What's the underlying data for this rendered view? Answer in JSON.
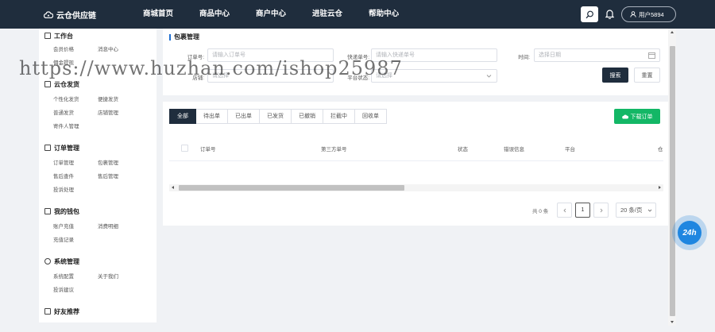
{
  "brand": {
    "name": "云仓供应链"
  },
  "nav": {
    "items": [
      "商城首页",
      "商品中心",
      "商户中心",
      "进驻云仓",
      "帮助中心"
    ]
  },
  "user": {
    "label": "用户5894"
  },
  "sidebar": {
    "sections": [
      {
        "title": "工作台",
        "icon": "desktop-icon",
        "items": [
          "会员价格",
          "消息中心",
          "佣金提现"
        ]
      },
      {
        "title": "云仓发货",
        "icon": "grid-icon",
        "items": [
          "个性化发货",
          "便捷发货",
          "普通发货",
          "店铺管理",
          "寄件人管理"
        ]
      },
      {
        "title": "订单管理",
        "icon": "list-icon",
        "items": [
          "订单管理",
          "包裹管理",
          "售后查件",
          "售后管理",
          "投诉处理"
        ]
      },
      {
        "title": "我的钱包",
        "icon": "wallet-icon",
        "items": [
          "账户充值",
          "消费明细",
          "充值记录"
        ]
      },
      {
        "title": "系统管理",
        "icon": "gear-icon",
        "items": [
          "系统配置",
          "关于我们",
          "投诉建议"
        ]
      },
      {
        "title": "好友推荐",
        "icon": "gift-icon",
        "items": []
      }
    ]
  },
  "filter": {
    "title": "包裹管理",
    "order_label": "订单号:",
    "order_placeholder": "请输入订单号",
    "express_label": "快递单号:",
    "express_placeholder": "请输入快递单号",
    "time_label": "时间:",
    "time_placeholder": "选择日期",
    "shop_label": "店铺:",
    "shop_placeholder": "请选择",
    "platform_label": "平台状态:",
    "platform_placeholder": "请选择",
    "search_label": "搜索",
    "reset_label": "重置"
  },
  "table": {
    "tabs": [
      "全部",
      "待出单",
      "已出单",
      "已发货",
      "已撤销",
      "拦截中",
      "回收单"
    ],
    "active_tab": 0,
    "download_label": "下载订单",
    "columns": [
      "订单号",
      "第三方单号",
      "状态",
      "错误信息",
      "平台",
      "仓"
    ]
  },
  "pager": {
    "total": "共 0 条",
    "current": "1",
    "page_size": "20 条/页"
  },
  "support": {
    "label": "24h"
  },
  "watermark": {
    "text": "https://www.huzhan.com/ishop25987"
  },
  "colors": {
    "nav_bg": "#1f2d3d",
    "download_green": "#13b766",
    "accent_blue": "#1f6fd1"
  }
}
